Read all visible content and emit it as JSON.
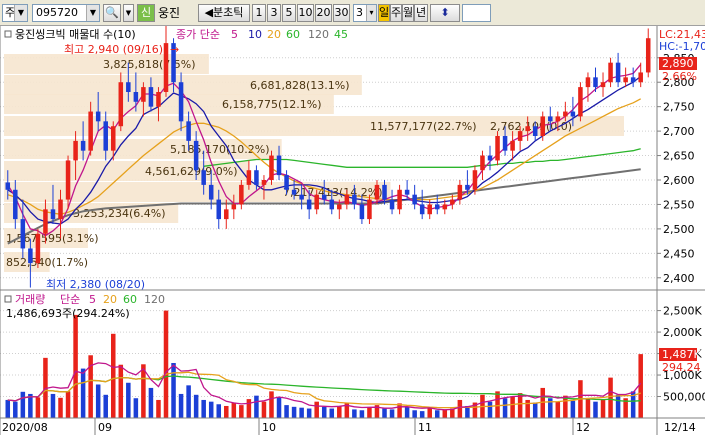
{
  "toolbar": {
    "market_label": "주",
    "code_value": "095720",
    "new_label": "신",
    "stock_name": "웅진",
    "tick_label": "◀분초틱",
    "periods": [
      "1",
      "3",
      "5",
      "10",
      "20",
      "30"
    ],
    "count_value": "3",
    "day_label": "일",
    "week_label": "주",
    "month_label": "월",
    "year_label": "년",
    "updown_label": "⬍"
  },
  "colors": {
    "up": "#e8231a",
    "down": "#1c3fd6",
    "ma5": "#c0168c",
    "ma10": "#1a1aa8",
    "ma20": "#e6a11c",
    "ma60": "#2bb52b",
    "ma120": "#707070",
    "band": "#f6e6cf"
  },
  "chart_data": [
    {
      "type": "candlestick",
      "title": "웅진씽크빅 매물대 수(10)",
      "legend": {
        "prefix": "종가 단순",
        "items": [
          {
            "label": "5",
            "color": "#c0168c"
          },
          {
            "label": "10",
            "color": "#1a1aa8"
          },
          {
            "label": "20",
            "color": "#e6a11c"
          },
          {
            "label": "60",
            "color": "#2bb52b"
          },
          {
            "label": "120",
            "color": "#2bb52b"
          }
        ]
      },
      "y_ticks": [
        "2,850",
        "2,800",
        "2,750",
        "2,700",
        "2,650",
        "2,600",
        "2,550",
        "2,500",
        "2,450",
        "2,400"
      ],
      "ylim": [
        2375,
        2915
      ],
      "x_labels": [
        "2020/08",
        "09",
        "10",
        "11",
        "12",
        "12/14"
      ],
      "high_label": "최고 2,940 (09/16)",
      "low_label": "최저 2,380 (08/20)",
      "right_labels": {
        "lc": "LC:21,43",
        "hc": "HC:-1,70",
        "price": "2,890",
        "pct": "2.66%"
      },
      "volume_profile": [
        {
          "label": "852,540(1.7%)",
          "price": 2400,
          "value": 852540
        },
        {
          "label": "1,567,595(3.1%)",
          "price": 2455,
          "value": 1567595
        },
        {
          "label": "3,253,234(6.4%)",
          "price": 2510,
          "value": 3253234
        },
        {
          "label": "4,561,629(9.0%)",
          "price": 2565,
          "value": 4561629
        },
        {
          "label": "7,217,413(14.2%)",
          "price": 2570,
          "value": 7217413
        },
        {
          "label": "5,185,170(10.2%)",
          "price": 2620,
          "value": 5185170
        },
        {
          "label": "11,577,177(22.7%)",
          "price": 2675,
          "value": 11577177
        },
        {
          "label": "2,762,109(0.0)",
          "price": 2675,
          "value": 2762109
        },
        {
          "label": "6,158,775(12.1%)",
          "price": 2730,
          "value": 6158775
        },
        {
          "label": "6,681,828(13.1%)",
          "price": 2785,
          "value": 6681828
        },
        {
          "label": "3,825,818(7.5%)",
          "price": 2840,
          "value": 3825818
        }
      ],
      "candles": [
        {
          "o": 2595,
          "h": 2620,
          "l": 2560,
          "c": 2580
        },
        {
          "o": 2580,
          "h": 2600,
          "l": 2500,
          "c": 2520
        },
        {
          "o": 2520,
          "h": 2560,
          "l": 2440,
          "c": 2460
        },
        {
          "o": 2460,
          "h": 2480,
          "l": 2380,
          "c": 2430
        },
        {
          "o": 2430,
          "h": 2500,
          "l": 2420,
          "c": 2490
        },
        {
          "o": 2490,
          "h": 2560,
          "l": 2470,
          "c": 2540
        },
        {
          "o": 2540,
          "h": 2590,
          "l": 2510,
          "c": 2520
        },
        {
          "o": 2520,
          "h": 2580,
          "l": 2480,
          "c": 2560
        },
        {
          "o": 2560,
          "h": 2650,
          "l": 2540,
          "c": 2640
        },
        {
          "o": 2640,
          "h": 2700,
          "l": 2600,
          "c": 2680
        },
        {
          "o": 2680,
          "h": 2720,
          "l": 2640,
          "c": 2660
        },
        {
          "o": 2660,
          "h": 2760,
          "l": 2650,
          "c": 2740
        },
        {
          "o": 2740,
          "h": 2780,
          "l": 2700,
          "c": 2720
        },
        {
          "o": 2720,
          "h": 2740,
          "l": 2640,
          "c": 2660
        },
        {
          "o": 2660,
          "h": 2720,
          "l": 2640,
          "c": 2710
        },
        {
          "o": 2710,
          "h": 2820,
          "l": 2700,
          "c": 2800
        },
        {
          "o": 2800,
          "h": 2840,
          "l": 2760,
          "c": 2780
        },
        {
          "o": 2780,
          "h": 2820,
          "l": 2740,
          "c": 2760
        },
        {
          "o": 2760,
          "h": 2800,
          "l": 2730,
          "c": 2790
        },
        {
          "o": 2790,
          "h": 2810,
          "l": 2740,
          "c": 2750
        },
        {
          "o": 2750,
          "h": 2790,
          "l": 2720,
          "c": 2780
        },
        {
          "o": 2780,
          "h": 2940,
          "l": 2770,
          "c": 2880
        },
        {
          "o": 2880,
          "h": 2890,
          "l": 2780,
          "c": 2800
        },
        {
          "o": 2800,
          "h": 2820,
          "l": 2700,
          "c": 2720
        },
        {
          "o": 2720,
          "h": 2740,
          "l": 2660,
          "c": 2680
        },
        {
          "o": 2680,
          "h": 2700,
          "l": 2600,
          "c": 2620
        },
        {
          "o": 2620,
          "h": 2660,
          "l": 2570,
          "c": 2590
        },
        {
          "o": 2590,
          "h": 2620,
          "l": 2540,
          "c": 2560
        },
        {
          "o": 2560,
          "h": 2580,
          "l": 2500,
          "c": 2520
        },
        {
          "o": 2520,
          "h": 2560,
          "l": 2500,
          "c": 2540
        },
        {
          "o": 2540,
          "h": 2570,
          "l": 2520,
          "c": 2550
        },
        {
          "o": 2550,
          "h": 2600,
          "l": 2540,
          "c": 2590
        },
        {
          "o": 2590,
          "h": 2640,
          "l": 2580,
          "c": 2620
        },
        {
          "o": 2620,
          "h": 2630,
          "l": 2580,
          "c": 2590
        },
        {
          "o": 2590,
          "h": 2610,
          "l": 2560,
          "c": 2600
        },
        {
          "o": 2600,
          "h": 2660,
          "l": 2590,
          "c": 2650
        },
        {
          "o": 2650,
          "h": 2670,
          "l": 2600,
          "c": 2610
        },
        {
          "o": 2610,
          "h": 2620,
          "l": 2570,
          "c": 2580
        },
        {
          "o": 2580,
          "h": 2600,
          "l": 2560,
          "c": 2570
        },
        {
          "o": 2570,
          "h": 2590,
          "l": 2540,
          "c": 2560
        },
        {
          "o": 2560,
          "h": 2580,
          "l": 2520,
          "c": 2540
        },
        {
          "o": 2540,
          "h": 2580,
          "l": 2530,
          "c": 2570
        },
        {
          "o": 2570,
          "h": 2600,
          "l": 2550,
          "c": 2560
        },
        {
          "o": 2560,
          "h": 2580,
          "l": 2530,
          "c": 2540
        },
        {
          "o": 2540,
          "h": 2560,
          "l": 2520,
          "c": 2550
        },
        {
          "o": 2550,
          "h": 2580,
          "l": 2540,
          "c": 2570
        },
        {
          "o": 2570,
          "h": 2590,
          "l": 2540,
          "c": 2550
        },
        {
          "o": 2550,
          "h": 2570,
          "l": 2510,
          "c": 2520
        },
        {
          "o": 2520,
          "h": 2570,
          "l": 2510,
          "c": 2560
        },
        {
          "o": 2560,
          "h": 2600,
          "l": 2550,
          "c": 2590
        },
        {
          "o": 2590,
          "h": 2600,
          "l": 2550,
          "c": 2560
        },
        {
          "o": 2560,
          "h": 2580,
          "l": 2530,
          "c": 2540
        },
        {
          "o": 2540,
          "h": 2590,
          "l": 2530,
          "c": 2580
        },
        {
          "o": 2580,
          "h": 2600,
          "l": 2560,
          "c": 2570
        },
        {
          "o": 2570,
          "h": 2590,
          "l": 2540,
          "c": 2550
        },
        {
          "o": 2550,
          "h": 2580,
          "l": 2520,
          "c": 2530
        },
        {
          "o": 2530,
          "h": 2560,
          "l": 2520,
          "c": 2550
        },
        {
          "o": 2550,
          "h": 2570,
          "l": 2530,
          "c": 2540
        },
        {
          "o": 2540,
          "h": 2560,
          "l": 2530,
          "c": 2550
        },
        {
          "o": 2550,
          "h": 2570,
          "l": 2540,
          "c": 2560
        },
        {
          "o": 2560,
          "h": 2600,
          "l": 2550,
          "c": 2590
        },
        {
          "o": 2590,
          "h": 2620,
          "l": 2570,
          "c": 2580
        },
        {
          "o": 2580,
          "h": 2630,
          "l": 2570,
          "c": 2620
        },
        {
          "o": 2620,
          "h": 2660,
          "l": 2600,
          "c": 2650
        },
        {
          "o": 2650,
          "h": 2670,
          "l": 2620,
          "c": 2640
        },
        {
          "o": 2640,
          "h": 2700,
          "l": 2630,
          "c": 2690
        },
        {
          "o": 2690,
          "h": 2710,
          "l": 2650,
          "c": 2660
        },
        {
          "o": 2660,
          "h": 2700,
          "l": 2640,
          "c": 2680
        },
        {
          "o": 2680,
          "h": 2710,
          "l": 2660,
          "c": 2700
        },
        {
          "o": 2700,
          "h": 2730,
          "l": 2680,
          "c": 2710
        },
        {
          "o": 2710,
          "h": 2720,
          "l": 2680,
          "c": 2690
        },
        {
          "o": 2690,
          "h": 2740,
          "l": 2680,
          "c": 2730
        },
        {
          "o": 2730,
          "h": 2750,
          "l": 2700,
          "c": 2720
        },
        {
          "o": 2720,
          "h": 2740,
          "l": 2700,
          "c": 2730
        },
        {
          "o": 2730,
          "h": 2760,
          "l": 2720,
          "c": 2740
        },
        {
          "o": 2740,
          "h": 2770,
          "l": 2710,
          "c": 2730
        },
        {
          "o": 2730,
          "h": 2800,
          "l": 2720,
          "c": 2790
        },
        {
          "o": 2790,
          "h": 2820,
          "l": 2760,
          "c": 2810
        },
        {
          "o": 2810,
          "h": 2830,
          "l": 2780,
          "c": 2790
        },
        {
          "o": 2790,
          "h": 2820,
          "l": 2770,
          "c": 2800
        },
        {
          "o": 2800,
          "h": 2850,
          "l": 2790,
          "c": 2840
        },
        {
          "o": 2840,
          "h": 2860,
          "l": 2790,
          "c": 2800
        },
        {
          "o": 2800,
          "h": 2830,
          "l": 2790,
          "c": 2810
        },
        {
          "o": 2810,
          "h": 2830,
          "l": 2790,
          "c": 2800
        },
        {
          "o": 2800,
          "h": 2840,
          "l": 2790,
          "c": 2820
        },
        {
          "o": 2820,
          "h": 2910,
          "l": 2810,
          "c": 2890
        }
      ],
      "ma5": [
        2590,
        2565,
        2530,
        2500,
        2496,
        2486,
        2496,
        2510,
        2542,
        2588,
        2620,
        2660,
        2700,
        2712,
        2702,
        2726,
        2740,
        2752,
        2776,
        2776,
        2772,
        2792,
        2798,
        2782,
        2760,
        2720,
        2682,
        2636,
        2598,
        2566,
        2552,
        2552,
        2566,
        2578,
        2590,
        2610,
        2614,
        2610,
        2602,
        2594,
        2572,
        2564,
        2560,
        2556,
        2554,
        2556,
        2552,
        2548,
        2550,
        2556,
        2560,
        2566,
        2570,
        2566,
        2554,
        2546,
        2540,
        2544,
        2546,
        2550,
        2566,
        2578,
        2598,
        2620,
        2638,
        2652,
        2666,
        2680,
        2688,
        2692,
        2702,
        2712,
        2714,
        2720,
        2730,
        2744,
        2762,
        2772,
        2786,
        2796,
        2808,
        2812,
        2814,
        2818,
        2836
      ],
      "ma10": [
        2580,
        2570,
        2555,
        2535,
        2520,
        2515,
        2512,
        2510,
        2520,
        2540,
        2555,
        2575,
        2600,
        2628,
        2648,
        2672,
        2690,
        2706,
        2734,
        2742,
        2750,
        2764,
        2778,
        2772,
        2766,
        2756,
        2740,
        2710,
        2690,
        2670,
        2640,
        2620,
        2600,
        2590,
        2580,
        2580,
        2584,
        2588,
        2590,
        2590,
        2590,
        2588,
        2584,
        2576,
        2572,
        2566,
        2562,
        2560,
        2556,
        2554,
        2556,
        2558,
        2560,
        2560,
        2558,
        2556,
        2554,
        2554,
        2556,
        2558,
        2560,
        2566,
        2580,
        2594,
        2604,
        2616,
        2630,
        2644,
        2658,
        2666,
        2680,
        2690,
        2700,
        2708,
        2716,
        2726,
        2736,
        2744,
        2754,
        2764,
        2774,
        2784,
        2792,
        2800,
        2812
      ],
      "ma20": [
        2570,
        2565,
        2558,
        2550,
        2540,
        2535,
        2532,
        2530,
        2534,
        2540,
        2548,
        2556,
        2566,
        2580,
        2594,
        2608,
        2622,
        2636,
        2650,
        2662,
        2674,
        2686,
        2698,
        2706,
        2712,
        2716,
        2716,
        2712,
        2708,
        2700,
        2690,
        2678,
        2664,
        2650,
        2636,
        2624,
        2614,
        2606,
        2598,
        2592,
        2586,
        2582,
        2578,
        2574,
        2572,
        2570,
        2568,
        2566,
        2564,
        2562,
        2560,
        2560,
        2560,
        2560,
        2560,
        2560,
        2560,
        2562,
        2564,
        2566,
        2568,
        2572,
        2578,
        2584,
        2592,
        2600,
        2610,
        2620,
        2630,
        2640,
        2650,
        2660,
        2670,
        2680,
        2690,
        2698,
        2706,
        2714,
        2722,
        2730,
        2738,
        2746,
        2752,
        2758,
        2766
      ],
      "ma60": [
        null,
        null,
        null,
        null,
        null,
        null,
        null,
        null,
        null,
        null,
        null,
        null,
        null,
        null,
        null,
        null,
        null,
        null,
        null,
        null,
        null,
        null,
        null,
        null,
        null,
        null,
        2628,
        2630,
        2632,
        2634,
        2636,
        2638,
        2640,
        2642,
        2642,
        2642,
        2642,
        2642,
        2640,
        2638,
        2636,
        2634,
        2632,
        2630,
        2628,
        2626,
        2626,
        2626,
        2626,
        2626,
        2626,
        2626,
        2626,
        2626,
        2626,
        2626,
        2626,
        2626,
        2626,
        2626,
        2626,
        2626,
        2628,
        2630,
        2630,
        2632,
        2634,
        2634,
        2636,
        2636,
        2638,
        2638,
        2640,
        2640,
        2642,
        2644,
        2646,
        2648,
        2650,
        2652,
        2654,
        2656,
        2658,
        2660,
        2664
      ],
      "ma120": [
        2470,
        2478,
        2486,
        2494,
        2502,
        2510,
        2516,
        2522,
        2528,
        2532,
        2536,
        2538,
        2540,
        2542,
        2543,
        2544,
        2545,
        2546,
        2547,
        2548,
        2549,
        2550,
        2551,
        2552,
        2552,
        2552,
        2552,
        2552,
        2552,
        2552,
        2552,
        2552,
        2552,
        2552,
        2552,
        2552,
        2552,
        2552,
        2552,
        2552,
        2552,
        2552,
        2552,
        2552,
        2552,
        2552,
        2552,
        2552,
        2552,
        2552,
        2554,
        2556,
        2558,
        2560,
        2562,
        2564,
        2566,
        2568,
        2570,
        2572,
        2574,
        2576,
        2578,
        2580,
        2582,
        2584,
        2586,
        2588,
        2590,
        2592,
        2594,
        2596,
        2598,
        2600,
        2602,
        2604,
        2606,
        2608,
        2610,
        2612,
        2614,
        2616,
        2618,
        2620,
        2622
      ]
    },
    {
      "type": "bar",
      "title": "거래량",
      "legend": {
        "prefix": "단순",
        "items": [
          {
            "label": "5",
            "color": "#c0168c"
          },
          {
            "label": "20",
            "color": "#e6a11c"
          },
          {
            "label": "60",
            "color": "#2bb52b"
          },
          {
            "label": "120",
            "color": "#707070"
          }
        ]
      },
      "info_label": "1,486,693주(294.24%)",
      "y_ticks": [
        "2,500K",
        "2,000K",
        "1,500K",
        "1,000K",
        "500,000"
      ],
      "ylim": [
        0,
        2700
      ],
      "right_labels": {
        "value": "1,487K",
        "pct": "294.24"
      },
      "volumes": [
        420,
        380,
        610,
        560,
        480,
        1400,
        560,
        470,
        620,
        2400,
        1150,
        1460,
        780,
        540,
        1960,
        1240,
        820,
        460,
        1250,
        700,
        420,
        2500,
        1280,
        560,
        760,
        540,
        420,
        380,
        320,
        280,
        360,
        300,
        440,
        520,
        380,
        620,
        480,
        300,
        260,
        240,
        220,
        380,
        260,
        220,
        280,
        340,
        200,
        180,
        240,
        300,
        220,
        200,
        340,
        260,
        180,
        160,
        240,
        180,
        200,
        220,
        420,
        280,
        360,
        540,
        380,
        620,
        460,
        500,
        580,
        420,
        360,
        700,
        460,
        380,
        520,
        400,
        880,
        460,
        380,
        420,
        940,
        540,
        460,
        620,
        1487
      ]
    }
  ]
}
